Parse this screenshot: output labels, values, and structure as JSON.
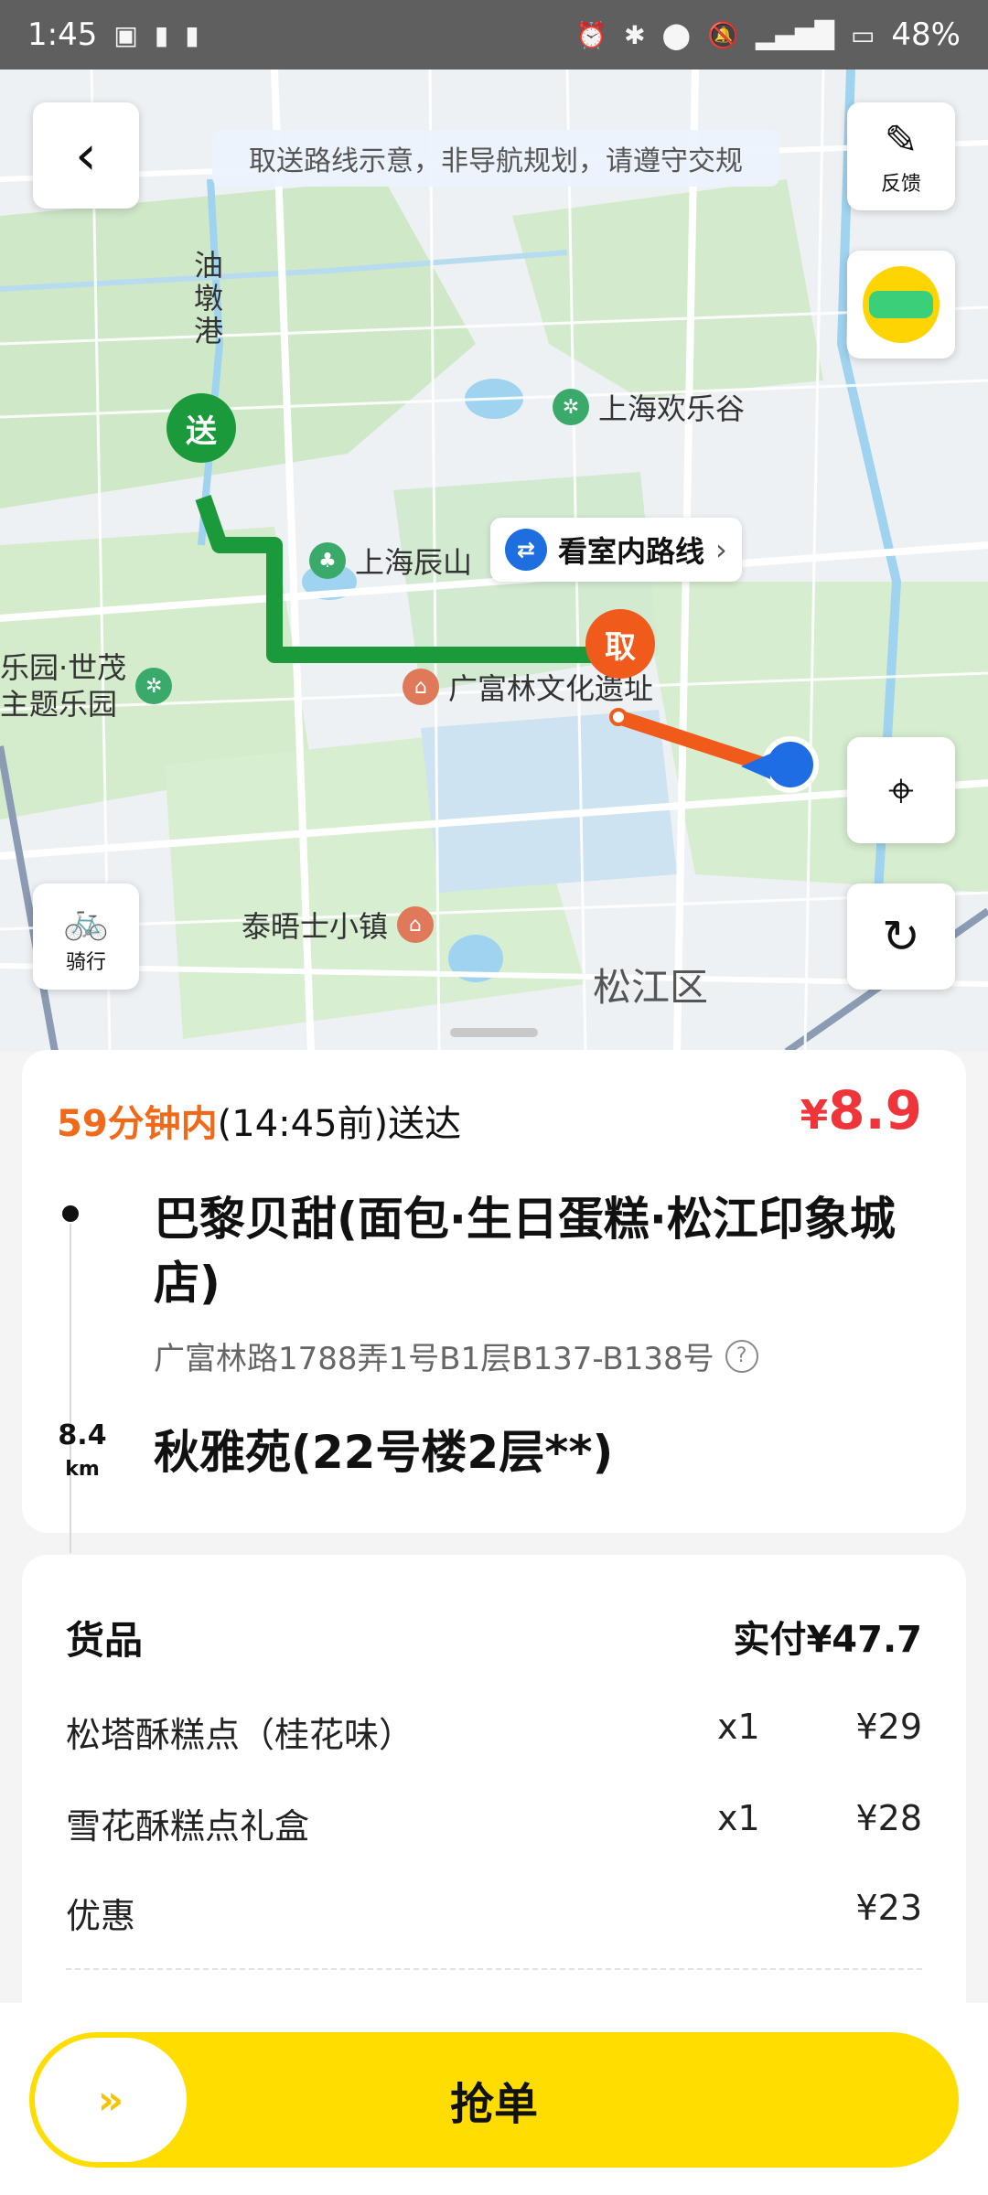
{
  "status": {
    "time": "1:45",
    "battery": "48%"
  },
  "map": {
    "tip": "取送路线示意，非导航规划，请遵守交规",
    "feedback_label": "反馈",
    "ride_label": "骑行",
    "indoor_route_label": "看室内路线",
    "pin_deliver": "送",
    "pin_pickup": "取",
    "labels": {
      "youdun": "油\n墩\n港",
      "happy_valley": "上海欢乐谷",
      "chenshan": "上海辰山",
      "guangfulin": "广富林文化遗址",
      "shimao": "乐园·世茂\n主题乐园",
      "thames": "泰晤士小镇",
      "songjiang": "松江区"
    }
  },
  "order": {
    "eta_highlight": "59分钟内",
    "eta_rest": "(14:45前)送达",
    "price_currency": "¥",
    "price_value": "8.9",
    "shop_name": "巴黎贝甜(面包·生日蛋糕·松江印象城店)",
    "shop_address": "广富林路1788弄1号B1层B137-B138号",
    "distance": "8.4",
    "distance_unit": "km",
    "destination": "秋雅苑(22号楼2层**)"
  },
  "goods": {
    "title": "货品",
    "paid": "实付¥47.7",
    "items": [
      {
        "name": "松塔酥糕点（桂花味）",
        "qty": "x1",
        "amount": "¥29"
      },
      {
        "name": "雪花酥糕点礼盒",
        "qty": "x1",
        "amount": "¥28"
      },
      {
        "name": "优惠",
        "qty": "",
        "amount": "¥23"
      }
    ]
  },
  "action": {
    "grab_label": "抢单",
    "slider_glyph": "»"
  },
  "colors": {
    "accent_yellow": "#ffdd00",
    "price_red": "#f0353a",
    "eta_orange": "#f06a1a",
    "route_green": "#1a9a3a",
    "route_orange": "#f05a1a"
  }
}
